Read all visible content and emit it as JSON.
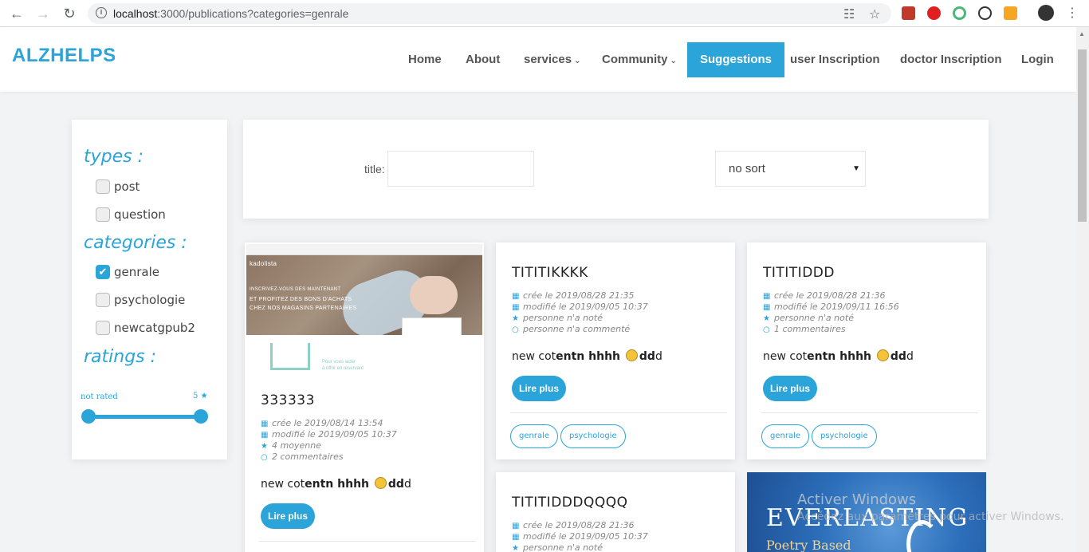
{
  "browser": {
    "url_host": "localhost",
    "url_path": ":3000/publications?categories=genrale"
  },
  "header": {
    "logo": "ALZHELPS",
    "nav": {
      "home": "Home",
      "about": "About",
      "services": "services",
      "community": "Community",
      "suggestions": "Suggestions",
      "user_inscription": "user Inscription",
      "doctor_inscription": "doctor Inscription",
      "login": "Login"
    },
    "active_item": "Suggestions",
    "accent_color": "#2aa4d9"
  },
  "sidebar": {
    "types_title": "types :",
    "types": [
      {
        "label": "post",
        "checked": false
      },
      {
        "label": "question",
        "checked": false
      }
    ],
    "categories_title": "categories :",
    "categories": [
      {
        "label": "genrale",
        "checked": true
      },
      {
        "label": "psychologie",
        "checked": false
      },
      {
        "label": "newcatgpub2",
        "checked": false
      }
    ],
    "ratings_title": "ratings :",
    "rating_min_label": "not rated",
    "rating_max_label": "5",
    "rating_range": [
      0,
      5
    ]
  },
  "search": {
    "title_label": "title:",
    "title_value": "",
    "sort_value": "no sort"
  },
  "cards": [
    {
      "title": "333333",
      "has_image": true,
      "image_texts": [
        "kadolista",
        "INSCRIVEZ-VOUS DES MAINTENANT",
        "ET PROFITEZ DES BONS D'ACHATS",
        "CHEZ NOS MAGASINS PARTENAIRES",
        "Pour vous aider",
        "à offrir en réservant"
      ],
      "created": "crée le 2019/08/14 13:54",
      "modified": "modifié le 2019/09/05 10:37",
      "rating": "4 moyenne",
      "comments": "2 commentaires",
      "excerpt_a": "new cot",
      "excerpt_b": "entn hhhh ",
      "excerpt_c": "dd",
      "excerpt_d": "d",
      "button": "Lire plus",
      "tags": []
    },
    {
      "title": "TITITIKKKK",
      "created": "crée le 2019/08/28 21:35",
      "modified": "modifié le 2019/09/05 10:37",
      "rating": "personne n'a noté",
      "comments": "personne n'a commenté",
      "excerpt_a": "new cot",
      "excerpt_b": "entn hhhh ",
      "excerpt_c": "dd",
      "excerpt_d": "d",
      "button": "Lire plus",
      "tags": [
        "genrale",
        "psychologie"
      ]
    },
    {
      "title": "TITITIDDD",
      "created": "crée le 2019/08/28 21:36",
      "modified": "modifié le 2019/09/11 16:56",
      "rating": "personne n'a noté",
      "comments": "1 commentaires",
      "excerpt_a": "new cot",
      "excerpt_b": "entn hhhh ",
      "excerpt_c": "dd",
      "excerpt_d": "d",
      "button": "Lire plus",
      "tags": [
        "genrale",
        "psychologie"
      ]
    },
    {
      "title": "TITITIDDDQQQQ",
      "created": "crée le 2019/08/28 21:36",
      "modified": "modifié le 2019/09/05 10:37",
      "rating": "personne n'a noté"
    },
    {
      "book_title": "EVERLASTING",
      "book_subtitle": "Poetry Based"
    }
  ],
  "watermark": {
    "line1": "Activer Windows",
    "line2": "Accédez aux paramètres pour activer Windows."
  }
}
